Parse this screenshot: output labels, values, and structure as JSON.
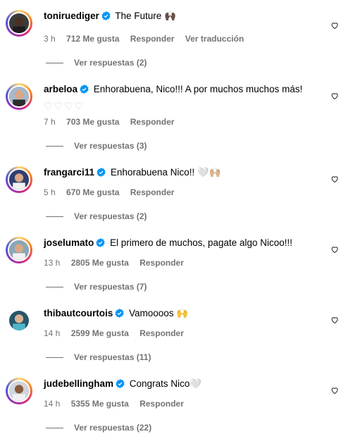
{
  "comments": [
    {
      "username": "toniruediger",
      "text": "The Future 🙌🏿",
      "hearts": "",
      "time": "3 h",
      "likes": "712 Me gusta",
      "reply": "Responder",
      "translate": "Ver traducción",
      "replies": "Ver respuestas (2)",
      "avatar": "dark-skin-player",
      "ring": true
    },
    {
      "username": "arbeloa",
      "text": "Enhorabuena, Nico!!! A por muchos muchos más!",
      "hearts": "♡♡♡♡",
      "time": "7 h",
      "likes": "703 Me gusta",
      "reply": "Responder",
      "translate": "",
      "replies": "Ver respuestas (3)",
      "avatar": "coach-arbeloa",
      "ring": true
    },
    {
      "username": "frangarci11",
      "text": "Enhorabuena Nico!! 🤍🙌🏼",
      "hearts": "",
      "time": "5 h",
      "likes": "670 Me gusta",
      "reply": "Responder",
      "translate": "",
      "replies": "Ver respuestas (2)",
      "avatar": "player-white-kit",
      "ring": true
    },
    {
      "username": "joselumato",
      "text": "El primero de muchos, pagate algo Nicoo!!!",
      "hearts": "",
      "time": "13 h",
      "likes": "2805 Me gusta",
      "reply": "Responder",
      "translate": "",
      "replies": "Ver respuestas (7)",
      "avatar": "player-white-kit",
      "ring": true
    },
    {
      "username": "thibautcourtois",
      "text": "Vamoooos 🙌",
      "hearts": "",
      "time": "14 h",
      "likes": "2599 Me gusta",
      "reply": "Responder",
      "translate": "",
      "replies": "Ver respuestas (11)",
      "avatar": "goalkeeper",
      "ring": false
    },
    {
      "username": "judebellingham",
      "text": "Congrats Nico🤍",
      "hearts": "",
      "time": "14 h",
      "likes": "5355 Me gusta",
      "reply": "Responder",
      "translate": "",
      "replies": "Ver respuestas (22)",
      "avatar": "player-white-kit",
      "ring": true
    }
  ],
  "colors": {
    "verified": "#0095f6",
    "secondary": "#737373",
    "like_heart": "#262626"
  }
}
